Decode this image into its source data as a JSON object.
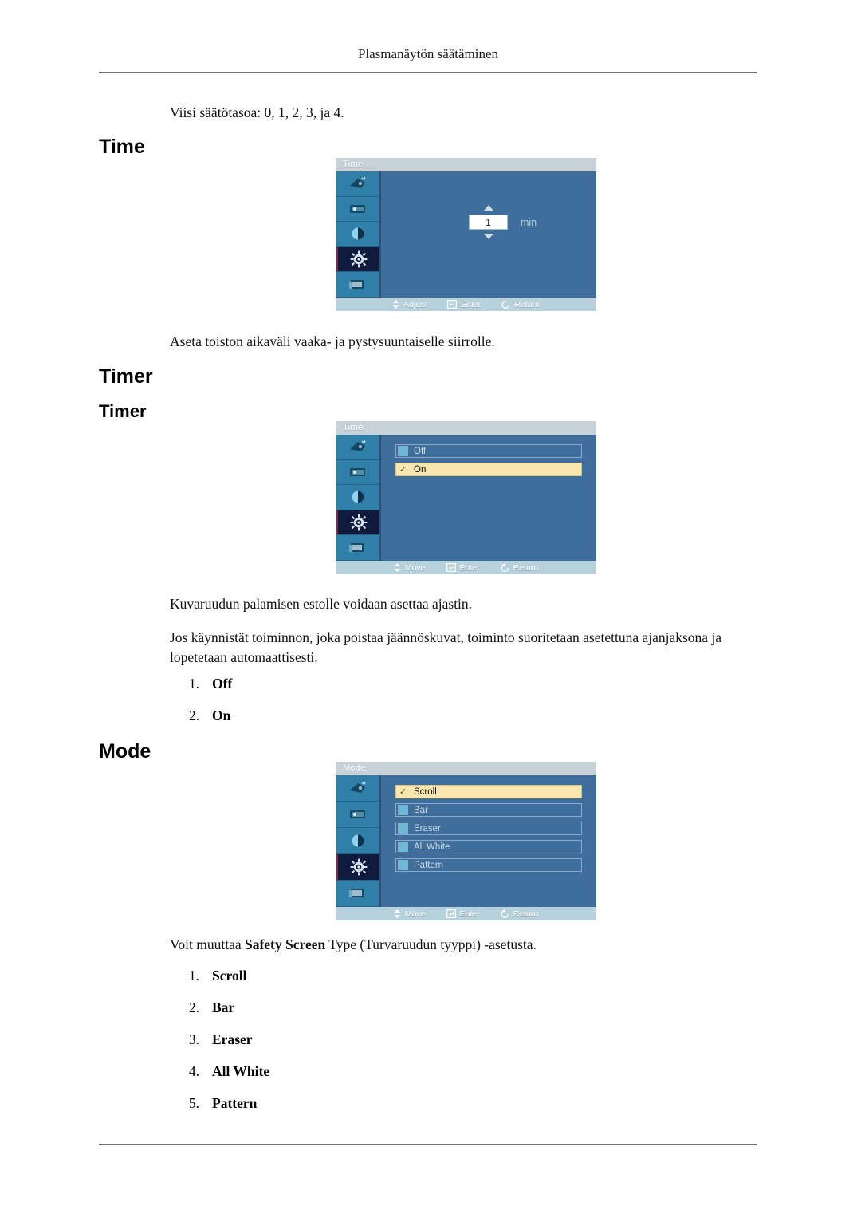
{
  "page": {
    "running_header": "Plasmanäytön säätäminen",
    "intro_text": "Viisi säätötasoa: 0, 1, 2, 3, ja 4."
  },
  "sections": [
    {
      "heading": "Time",
      "caption": "Aseta toiston aikaväli vaaka- ja pystysuuntaiselle siirrolle.",
      "osd": {
        "title": "Time",
        "value": "1",
        "unit": "min",
        "footer": {
          "move": "Adjust",
          "enter": "Enter",
          "return": "Return"
        }
      }
    },
    {
      "heading": "Timer",
      "subheading": "Timer",
      "paragraph_1": "Kuvaruudun palamisen estolle voidaan asettaa ajastin.",
      "paragraph_2": "Jos käynnistät toiminnon, joka poistaa jäännöskuvat, toiminto suoritetaan asetettuna ajanjaksona ja lopetetaan automaattisesti.",
      "osd": {
        "title": "Timer",
        "options": [
          {
            "label": "Off",
            "selected": false
          },
          {
            "label": "On",
            "selected": true
          }
        ],
        "footer": {
          "move": "Move",
          "enter": "Enter",
          "return": "Return"
        }
      },
      "list": [
        {
          "num": "1.",
          "label": "Off"
        },
        {
          "num": "2.",
          "label": "On"
        }
      ]
    },
    {
      "heading": "Mode",
      "caption_parts": {
        "before": "Voit muuttaa ",
        "bold": "Safety Screen",
        "after": " Type (Turvaruudun tyyppi) -asetusta."
      },
      "osd": {
        "title": "Mode",
        "options": [
          {
            "label": "Scroll",
            "selected": true
          },
          {
            "label": "Bar",
            "selected": false
          },
          {
            "label": "Eraser",
            "selected": false
          },
          {
            "label": "All White",
            "selected": false
          },
          {
            "label": "Pattern",
            "selected": false
          }
        ],
        "footer": {
          "move": "Move",
          "enter": "Enter",
          "return": "Return"
        }
      },
      "list": [
        {
          "num": "1.",
          "label": "Scroll"
        },
        {
          "num": "2.",
          "label": "Bar"
        },
        {
          "num": "3.",
          "label": "Eraser"
        },
        {
          "num": "4.",
          "label": "All White"
        },
        {
          "num": "5.",
          "label": "Pattern"
        }
      ]
    }
  ],
  "osd_sidebar_icons": [
    {
      "name": "picture-icon",
      "selected": false
    },
    {
      "name": "sound-icon",
      "selected": false
    },
    {
      "name": "contrast-icon",
      "selected": false
    },
    {
      "name": "setup-gear-icon",
      "selected": true
    },
    {
      "name": "multi-control-icon",
      "selected": false
    }
  ],
  "check_glyph": "✓",
  "colors": {
    "osd_panel": "#3f6e9c",
    "osd_title_bar": "#c7d2d8",
    "osd_sidebar_icon": "#2f7fa8",
    "osd_selected_icon": "#101a3c",
    "osd_footer": "#b7d2dd",
    "option_selected": "#fae6af",
    "option_marker": "#6fb8d6",
    "rule": "#6f6f6f"
  }
}
